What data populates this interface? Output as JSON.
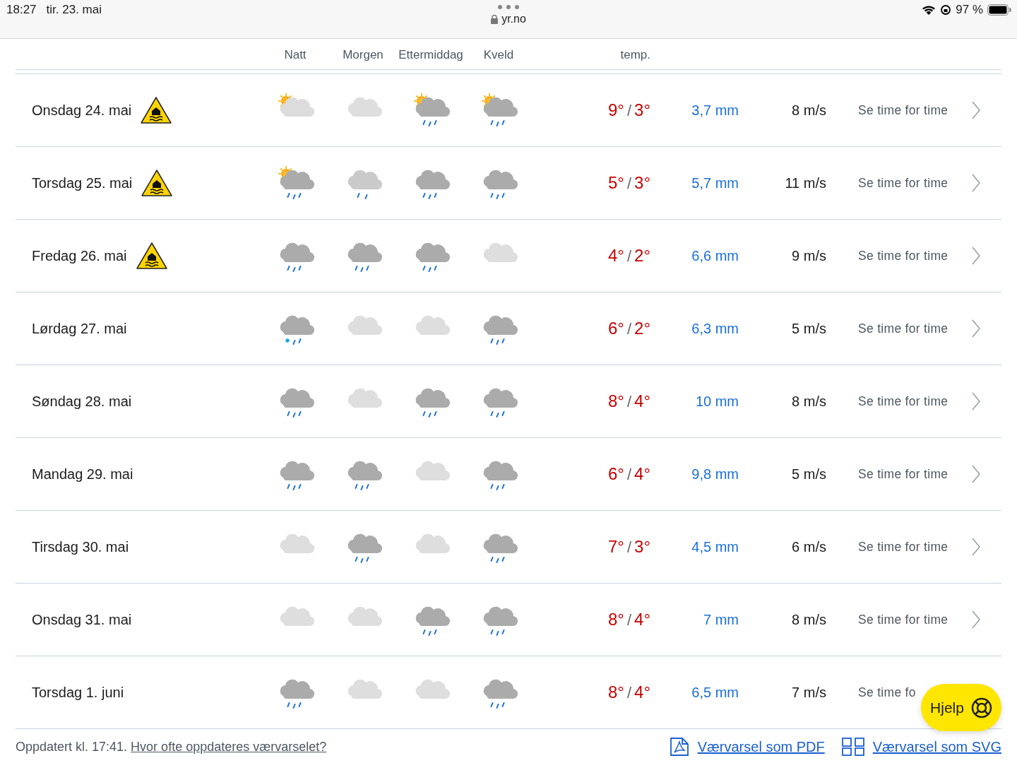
{
  "status_bar": {
    "time": "18:27",
    "date": "tir. 23. mai",
    "url": "yr.no",
    "battery": "97 %"
  },
  "header": {
    "periods": [
      "Natt",
      "Morgen",
      "Ettermiddag",
      "Kveld"
    ],
    "temp_label": "temp."
  },
  "days": [
    {
      "name": "Onsdag 24. mai",
      "warning": true,
      "icons": [
        {
          "kind": "partly-cloudy"
        },
        {
          "kind": "cloudy"
        },
        {
          "kind": "partly-rain"
        },
        {
          "kind": "partly-rain"
        }
      ],
      "temp_max": "9°",
      "temp_sep": "/",
      "temp_min": "3°",
      "precip": "3,7 mm",
      "wind": "8 m/s",
      "link": "Se time for time"
    },
    {
      "name": "Torsdag 25. mai",
      "warning": true,
      "icons": [
        {
          "kind": "partly-rain"
        },
        {
          "kind": "light-rain"
        },
        {
          "kind": "rain"
        },
        {
          "kind": "rain"
        }
      ],
      "temp_max": "5°",
      "temp_sep": "/",
      "temp_min": "3°",
      "precip": "5,7 mm",
      "wind": "11 m/s",
      "link": "Se time for time"
    },
    {
      "name": "Fredag 26. mai",
      "warning": true,
      "icons": [
        {
          "kind": "rain"
        },
        {
          "kind": "rain"
        },
        {
          "kind": "rain"
        },
        {
          "kind": "cloudy"
        }
      ],
      "temp_max": "4°",
      "temp_sep": "/",
      "temp_min": "2°",
      "precip": "6,6 mm",
      "wind": "9 m/s",
      "link": "Se time for time"
    },
    {
      "name": "Lørdag 27. mai",
      "warning": false,
      "icons": [
        {
          "kind": "sleet"
        },
        {
          "kind": "cloudy"
        },
        {
          "kind": "cloudy"
        },
        {
          "kind": "rain"
        }
      ],
      "temp_max": "6°",
      "temp_sep": "/",
      "temp_min": "2°",
      "precip": "6,3 mm",
      "wind": "5 m/s",
      "link": "Se time for time"
    },
    {
      "name": "Søndag 28. mai",
      "warning": false,
      "icons": [
        {
          "kind": "rain"
        },
        {
          "kind": "cloudy"
        },
        {
          "kind": "rain"
        },
        {
          "kind": "rain"
        }
      ],
      "temp_max": "8°",
      "temp_sep": "/",
      "temp_min": "4°",
      "precip": "10 mm",
      "wind": "8 m/s",
      "link": "Se time for time"
    },
    {
      "name": "Mandag 29. mai",
      "warning": false,
      "icons": [
        {
          "kind": "rain"
        },
        {
          "kind": "rain"
        },
        {
          "kind": "cloudy"
        },
        {
          "kind": "rain"
        }
      ],
      "temp_max": "6°",
      "temp_sep": "/",
      "temp_min": "4°",
      "precip": "9,8 mm",
      "wind": "5 m/s",
      "link": "Se time for time"
    },
    {
      "name": "Tirsdag 30. mai",
      "warning": false,
      "icons": [
        {
          "kind": "cloudy"
        },
        {
          "kind": "rain"
        },
        {
          "kind": "cloudy"
        },
        {
          "kind": "rain"
        }
      ],
      "temp_max": "7°",
      "temp_sep": "/",
      "temp_min": "3°",
      "precip": "4,5 mm",
      "wind": "6 m/s",
      "link": "Se time for time"
    },
    {
      "name": "Onsdag 31. mai",
      "warning": false,
      "icons": [
        {
          "kind": "cloudy"
        },
        {
          "kind": "cloudy"
        },
        {
          "kind": "rain"
        },
        {
          "kind": "rain"
        }
      ],
      "temp_max": "8°",
      "temp_sep": "/",
      "temp_min": "4°",
      "precip": "7 mm",
      "wind": "8 m/s",
      "link": "Se time for time"
    },
    {
      "name": "Torsdag 1. juni",
      "warning": false,
      "icons": [
        {
          "kind": "rain"
        },
        {
          "kind": "cloudy"
        },
        {
          "kind": "cloudy"
        },
        {
          "kind": "rain"
        }
      ],
      "temp_max": "8°",
      "temp_sep": "/",
      "temp_min": "4°",
      "precip": "6,5 mm",
      "wind": "7 m/s",
      "link": "Se time fo"
    }
  ],
  "footer": {
    "updated": "Oppdatert kl. 17:41.",
    "faq_link": "Hvor ofte oppdateres værvarselet?",
    "pdf_link": "Værvarsel som PDF",
    "svg_link": "Værvarsel som SVG"
  },
  "help_button": "Hjelp"
}
